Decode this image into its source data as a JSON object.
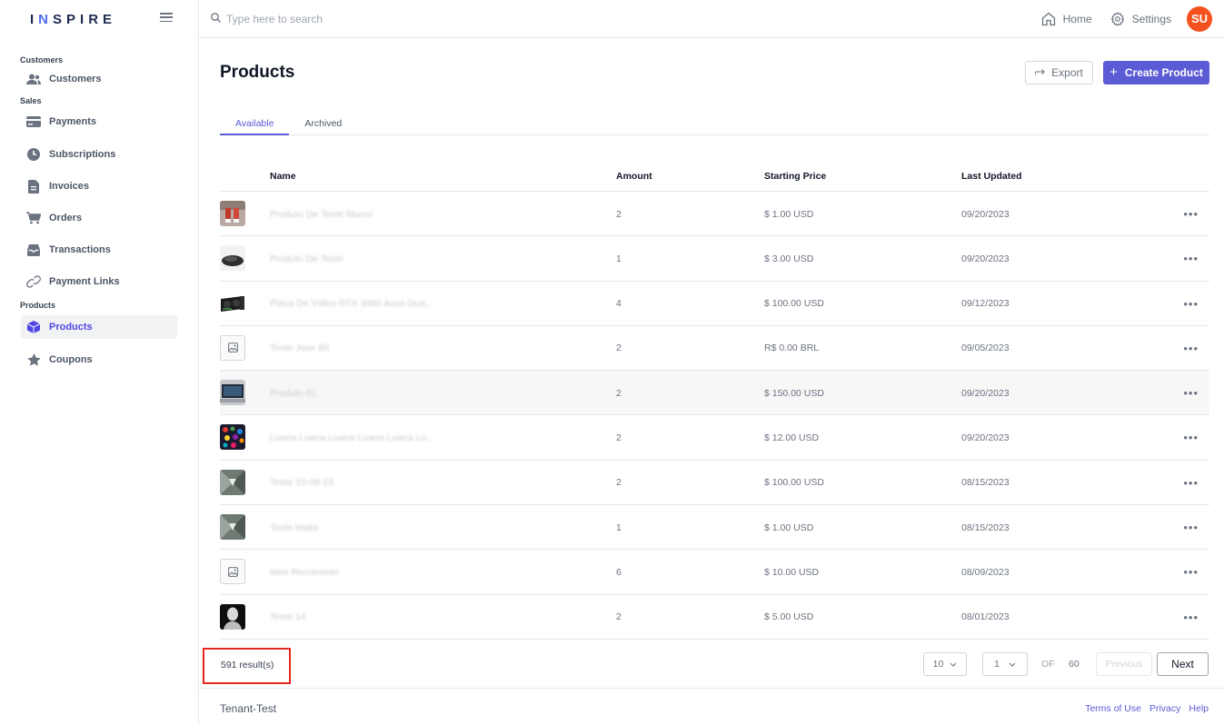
{
  "brand": {
    "logo_text_1": "I",
    "logo_accent": "N",
    "logo_text_2": "SPIRE"
  },
  "search": {
    "placeholder": "Type here to search"
  },
  "topnav": {
    "home": "Home",
    "settings": "Settings",
    "avatar_initials": "SU",
    "avatar_color": "#f4511e"
  },
  "sidebar": {
    "sections": {
      "customers": "Customers",
      "sales": "Sales",
      "products": "Products"
    },
    "items": {
      "customers": "Customers",
      "payments": "Payments",
      "subscriptions": "Subscriptions",
      "invoices": "Invoices",
      "orders": "Orders",
      "transactions": "Transactions",
      "payment_links": "Payment Links",
      "products": "Products",
      "coupons": "Coupons"
    },
    "active_item": "products"
  },
  "page": {
    "title": "Products",
    "export_label": "Export",
    "create_label": "Create Product",
    "accent_color": "#5b5bd6"
  },
  "tabs": {
    "available": "Available",
    "archived": "Archived",
    "active": "available"
  },
  "table": {
    "columns": {
      "name": "Name",
      "amount": "Amount",
      "starting_price": "Starting Price",
      "last_updated": "Last Updated"
    },
    "rows": [
      {
        "name": "Produto De Teste Marco",
        "amount": "2",
        "price": "$ 1.00 USD",
        "updated": "09/20/2023",
        "thumb": "sneakers-image"
      },
      {
        "name": "Produto De Teste",
        "amount": "1",
        "price": "$ 3.00 USD",
        "updated": "09/20/2023",
        "thumb": "mouse-image"
      },
      {
        "name": "Placa De Vídeo RTX 3080 Asus Dua...",
        "amount": "4",
        "price": "$ 100.00 USD",
        "updated": "09/12/2023",
        "thumb": "gpu-image"
      },
      {
        "name": "Teste Jose Bit",
        "amount": "2",
        "price": "R$ 0.00 BRL",
        "updated": "09/05/2023",
        "thumb": "placeholder"
      },
      {
        "name": "Produto 01",
        "amount": "2",
        "price": "$ 150.00 USD",
        "updated": "09/20/2023",
        "thumb": "laptop-image"
      },
      {
        "name": "Luana Luana Luana Luana Luana Lu...",
        "amount": "2",
        "price": "$ 12.00 USD",
        "updated": "09/20/2023",
        "thumb": "colorful-image"
      },
      {
        "name": "Teste 15-08-23",
        "amount": "2",
        "price": "$ 100.00 USD",
        "updated": "08/15/2023",
        "thumb": "abstract-image"
      },
      {
        "name": "Teste Make",
        "amount": "1",
        "price": "$ 1.00 USD",
        "updated": "08/15/2023",
        "thumb": "abstract-image"
      },
      {
        "name": "Item Recorrente",
        "amount": "6",
        "price": "$ 10.00 USD",
        "updated": "08/09/2023",
        "thumb": "placeholder"
      },
      {
        "name": "Teste 14",
        "amount": "2",
        "price": "$ 5.00 USD",
        "updated": "08/01/2023",
        "thumb": "bust-image"
      }
    ]
  },
  "pagination": {
    "results": "591 result(s)",
    "page_size": "10",
    "current_page": "1",
    "of_label": "OF",
    "total_pages": "60",
    "previous": "Previous",
    "next": "Next"
  },
  "footer": {
    "tenant": "Tenant-Test",
    "terms": "Terms of Use",
    "privacy": "Privacy",
    "help": "Help"
  }
}
